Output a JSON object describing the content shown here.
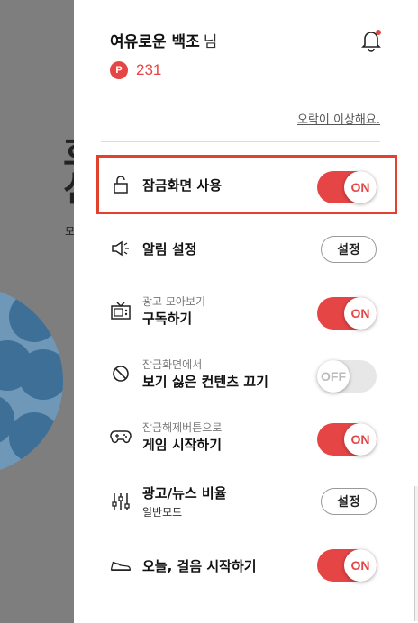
{
  "header": {
    "user_name": "여유로운 백조",
    "suffix": "님",
    "points_icon": "P",
    "points": "231"
  },
  "report_link": "오락이 이상해요.",
  "items": [
    {
      "title": "잠금화면 사용",
      "control": "toggle",
      "state": "ON"
    },
    {
      "title": "알림 설정",
      "control": "button",
      "button_label": "설정"
    },
    {
      "sub": "광고 모아보기",
      "title": "구독하기",
      "control": "toggle",
      "state": "ON"
    },
    {
      "sub": "잠금화면에서",
      "title": "보기 싫은 컨텐츠 끄기",
      "control": "toggle",
      "state": "OFF"
    },
    {
      "sub": "잠금해제버튼으로",
      "title": "게임 시작하기",
      "control": "toggle",
      "state": "ON"
    },
    {
      "title": "광고/뉴스 비율",
      "sub2": "일반모드",
      "control": "button",
      "button_label": "설정"
    },
    {
      "title": "오늘, 걸음 시작하기",
      "control": "toggle",
      "state": "ON"
    }
  ],
  "colors": {
    "accent": "#e64545",
    "highlight_border": "#e2412c"
  },
  "icons": [
    "bell-icon",
    "unlock-icon",
    "megaphone-icon",
    "tv-icon",
    "block-icon",
    "gamepad-icon",
    "sliders-icon",
    "sneaker-icon"
  ]
}
